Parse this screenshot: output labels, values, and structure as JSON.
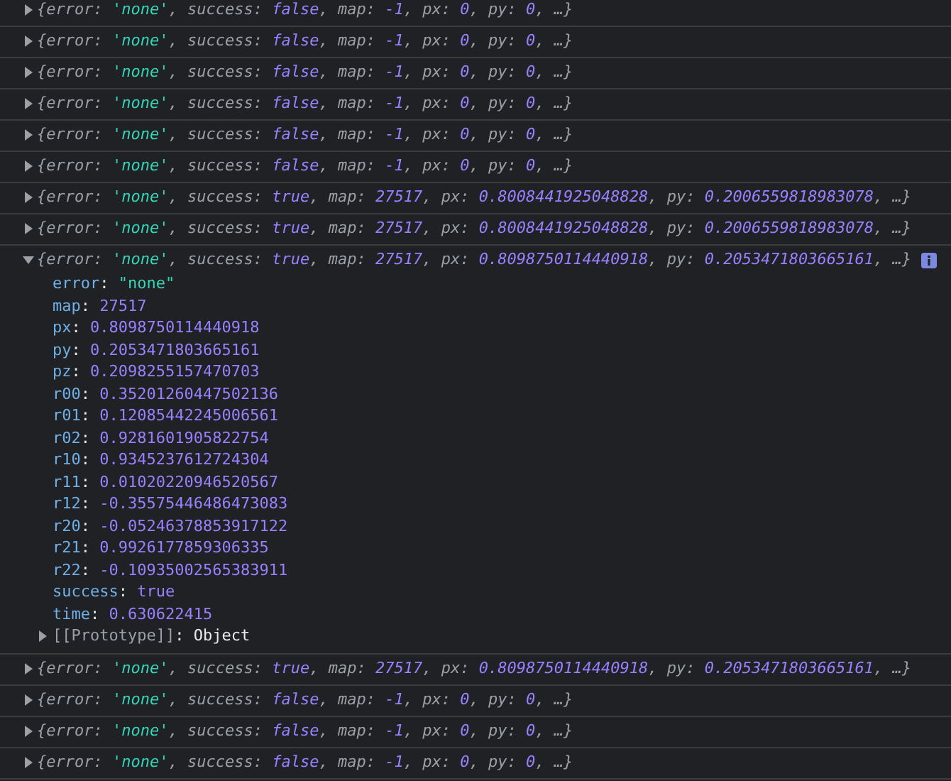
{
  "syntax": {
    "open": "{",
    "close": "}",
    "colon": ": ",
    "comma": ", ",
    "more": "…"
  },
  "entries": [
    {
      "expanded": false,
      "fields": [
        {
          "key": "error",
          "value": "'none'",
          "kind": "string"
        },
        {
          "key": "success",
          "value": "false",
          "kind": "literal"
        },
        {
          "key": "map",
          "value": "-1",
          "kind": "literal"
        },
        {
          "key": "px",
          "value": "0",
          "kind": "literal"
        },
        {
          "key": "py",
          "value": "0",
          "kind": "literal"
        }
      ]
    },
    {
      "expanded": false,
      "fields": [
        {
          "key": "error",
          "value": "'none'",
          "kind": "string"
        },
        {
          "key": "success",
          "value": "false",
          "kind": "literal"
        },
        {
          "key": "map",
          "value": "-1",
          "kind": "literal"
        },
        {
          "key": "px",
          "value": "0",
          "kind": "literal"
        },
        {
          "key": "py",
          "value": "0",
          "kind": "literal"
        }
      ]
    },
    {
      "expanded": false,
      "fields": [
        {
          "key": "error",
          "value": "'none'",
          "kind": "string"
        },
        {
          "key": "success",
          "value": "false",
          "kind": "literal"
        },
        {
          "key": "map",
          "value": "-1",
          "kind": "literal"
        },
        {
          "key": "px",
          "value": "0",
          "kind": "literal"
        },
        {
          "key": "py",
          "value": "0",
          "kind": "literal"
        }
      ]
    },
    {
      "expanded": false,
      "fields": [
        {
          "key": "error",
          "value": "'none'",
          "kind": "string"
        },
        {
          "key": "success",
          "value": "false",
          "kind": "literal"
        },
        {
          "key": "map",
          "value": "-1",
          "kind": "literal"
        },
        {
          "key": "px",
          "value": "0",
          "kind": "literal"
        },
        {
          "key": "py",
          "value": "0",
          "kind": "literal"
        }
      ]
    },
    {
      "expanded": false,
      "fields": [
        {
          "key": "error",
          "value": "'none'",
          "kind": "string"
        },
        {
          "key": "success",
          "value": "false",
          "kind": "literal"
        },
        {
          "key": "map",
          "value": "-1",
          "kind": "literal"
        },
        {
          "key": "px",
          "value": "0",
          "kind": "literal"
        },
        {
          "key": "py",
          "value": "0",
          "kind": "literal"
        }
      ]
    },
    {
      "expanded": false,
      "fields": [
        {
          "key": "error",
          "value": "'none'",
          "kind": "string"
        },
        {
          "key": "success",
          "value": "false",
          "kind": "literal"
        },
        {
          "key": "map",
          "value": "-1",
          "kind": "literal"
        },
        {
          "key": "px",
          "value": "0",
          "kind": "literal"
        },
        {
          "key": "py",
          "value": "0",
          "kind": "literal"
        }
      ]
    },
    {
      "expanded": false,
      "fields": [
        {
          "key": "error",
          "value": "'none'",
          "kind": "string"
        },
        {
          "key": "success",
          "value": "true",
          "kind": "literal"
        },
        {
          "key": "map",
          "value": "27517",
          "kind": "literal"
        },
        {
          "key": "px",
          "value": "0.8008441925048828",
          "kind": "literal"
        },
        {
          "key": "py",
          "value": "0.2006559818983078",
          "kind": "literal"
        }
      ]
    },
    {
      "expanded": false,
      "fields": [
        {
          "key": "error",
          "value": "'none'",
          "kind": "string"
        },
        {
          "key": "success",
          "value": "true",
          "kind": "literal"
        },
        {
          "key": "map",
          "value": "27517",
          "kind": "literal"
        },
        {
          "key": "px",
          "value": "0.8008441925048828",
          "kind": "literal"
        },
        {
          "key": "py",
          "value": "0.2006559818983078",
          "kind": "literal"
        }
      ]
    },
    {
      "expanded": true,
      "fields": [
        {
          "key": "error",
          "value": "'none'",
          "kind": "string"
        },
        {
          "key": "success",
          "value": "true",
          "kind": "literal"
        },
        {
          "key": "map",
          "value": "27517",
          "kind": "literal"
        },
        {
          "key": "px",
          "value": "0.8098750114440918",
          "kind": "literal"
        },
        {
          "key": "py",
          "value": "0.2053471803665161",
          "kind": "literal"
        }
      ],
      "properties": [
        {
          "key": "error",
          "value": "\"none\"",
          "kind": "string"
        },
        {
          "key": "map",
          "value": "27517",
          "kind": "literal"
        },
        {
          "key": "px",
          "value": "0.8098750114440918",
          "kind": "literal"
        },
        {
          "key": "py",
          "value": "0.2053471803665161",
          "kind": "literal"
        },
        {
          "key": "pz",
          "value": "0.2098255157470703",
          "kind": "literal"
        },
        {
          "key": "r00",
          "value": "0.35201260447502136",
          "kind": "literal"
        },
        {
          "key": "r01",
          "value": "0.12085442245006561",
          "kind": "literal"
        },
        {
          "key": "r02",
          "value": "0.9281601905822754",
          "kind": "literal"
        },
        {
          "key": "r10",
          "value": "0.9345237612724304",
          "kind": "literal"
        },
        {
          "key": "r11",
          "value": "0.01020220946520567",
          "kind": "literal"
        },
        {
          "key": "r12",
          "value": "-0.35575446486473083",
          "kind": "literal"
        },
        {
          "key": "r20",
          "value": "-0.05246378853917122",
          "kind": "literal"
        },
        {
          "key": "r21",
          "value": "0.9926177859306335",
          "kind": "literal"
        },
        {
          "key": "r22",
          "value": "-0.10935002565383911",
          "kind": "literal"
        },
        {
          "key": "success",
          "value": "true",
          "kind": "literal"
        },
        {
          "key": "time",
          "value": "0.630622415",
          "kind": "literal"
        },
        {
          "key": "[[Prototype]]",
          "value": "Object",
          "kind": "object"
        }
      ]
    },
    {
      "expanded": false,
      "fields": [
        {
          "key": "error",
          "value": "'none'",
          "kind": "string"
        },
        {
          "key": "success",
          "value": "true",
          "kind": "literal"
        },
        {
          "key": "map",
          "value": "27517",
          "kind": "literal"
        },
        {
          "key": "px",
          "value": "0.8098750114440918",
          "kind": "literal"
        },
        {
          "key": "py",
          "value": "0.2053471803665161",
          "kind": "literal"
        }
      ]
    },
    {
      "expanded": false,
      "fields": [
        {
          "key": "error",
          "value": "'none'",
          "kind": "string"
        },
        {
          "key": "success",
          "value": "false",
          "kind": "literal"
        },
        {
          "key": "map",
          "value": "-1",
          "kind": "literal"
        },
        {
          "key": "px",
          "value": "0",
          "kind": "literal"
        },
        {
          "key": "py",
          "value": "0",
          "kind": "literal"
        }
      ]
    },
    {
      "expanded": false,
      "fields": [
        {
          "key": "error",
          "value": "'none'",
          "kind": "string"
        },
        {
          "key": "success",
          "value": "false",
          "kind": "literal"
        },
        {
          "key": "map",
          "value": "-1",
          "kind": "literal"
        },
        {
          "key": "px",
          "value": "0",
          "kind": "literal"
        },
        {
          "key": "py",
          "value": "0",
          "kind": "literal"
        }
      ]
    },
    {
      "expanded": false,
      "fields": [
        {
          "key": "error",
          "value": "'none'",
          "kind": "string"
        },
        {
          "key": "success",
          "value": "false",
          "kind": "literal"
        },
        {
          "key": "map",
          "value": "-1",
          "kind": "literal"
        },
        {
          "key": "px",
          "value": "0",
          "kind": "literal"
        },
        {
          "key": "py",
          "value": "0",
          "kind": "literal"
        }
      ]
    }
  ]
}
